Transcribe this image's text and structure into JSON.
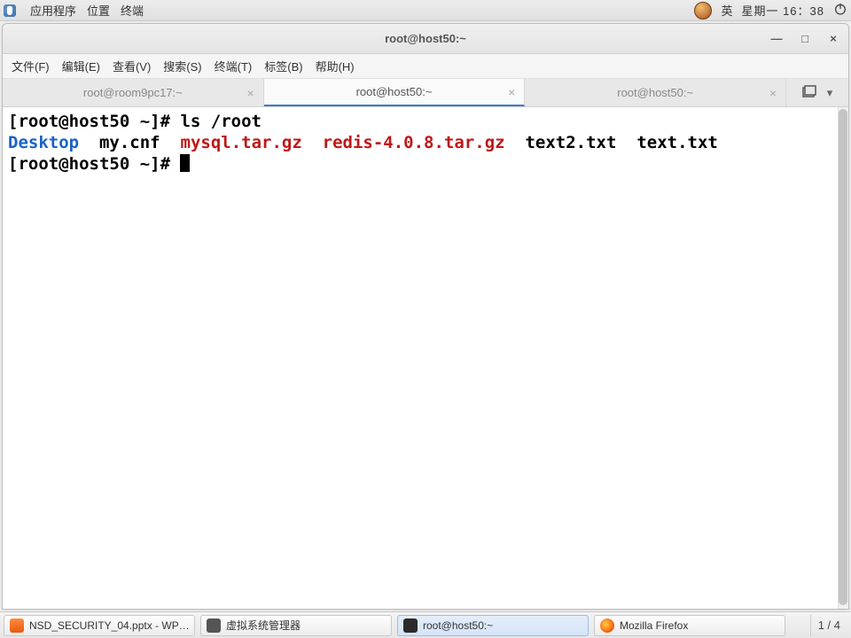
{
  "topbar": {
    "apps": "应用程序",
    "places": "位置",
    "terminal": "终端",
    "lang": "英",
    "datetime": "星期一 16：38"
  },
  "window": {
    "title": "root@host50:~",
    "controls": {
      "min": "—",
      "max": "□",
      "close": "×"
    },
    "menus": {
      "file": "文件(F)",
      "edit": "编辑(E)",
      "view": "查看(V)",
      "search": "搜索(S)",
      "terminal": "终端(T)",
      "tabs": "标签(B)",
      "help": "帮助(H)"
    },
    "tabs": [
      {
        "label": "root@room9pc17:~"
      },
      {
        "label": "root@host50:~"
      },
      {
        "label": "root@host50:~"
      }
    ]
  },
  "terminal": {
    "prompt": "[root@host50 ~]# ",
    "cmd1": "ls /root",
    "files": {
      "desktop": "Desktop",
      "mycnf": "my.cnf",
      "mysql": "mysql.tar.gz",
      "redis": "redis-4.0.8.tar.gz",
      "text2": "text2.txt",
      "text": "text.txt"
    }
  },
  "taskbar": {
    "items": [
      {
        "label": "NSD_SECURITY_04.pptx - WP…"
      },
      {
        "label": "虚拟系统管理器"
      },
      {
        "label": "root@host50:~"
      },
      {
        "label": "Mozilla Firefox"
      }
    ],
    "workspace": "1 / 4"
  }
}
